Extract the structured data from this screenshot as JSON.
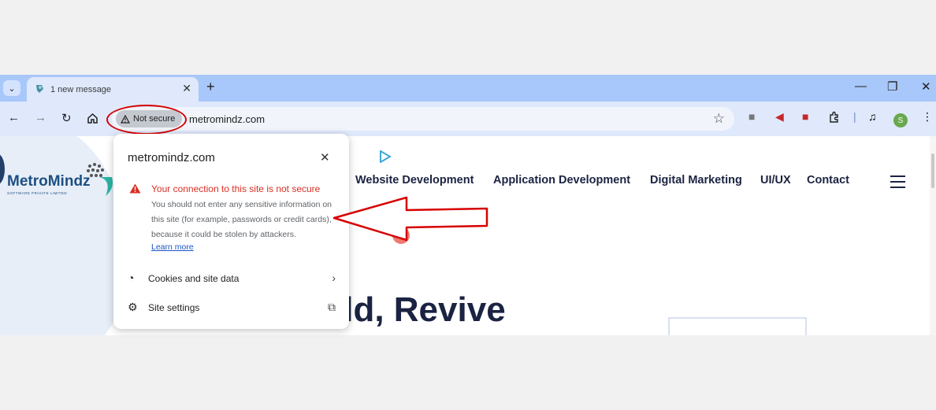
{
  "browser": {
    "tab_title": "1 new message",
    "tab_close": "✕",
    "new_tab": "+",
    "security_chip": "Not secure",
    "url": "metromindz.com",
    "window_controls": {
      "minimize": "—",
      "maximize": "❐",
      "close": "✕"
    },
    "profile_initial": "S"
  },
  "popup": {
    "domain": "metromindz.com",
    "warning_title": "Your connection to this site is not secure",
    "warning_body": "You should not enter any sensitive information on this site (for example, passwords or credit cards), because it could be stolen by attackers.",
    "learn_more": "Learn more",
    "cookies_label": "Cookies and site data",
    "site_settings_label": "Site settings"
  },
  "site": {
    "logo_text_1": "Metro",
    "logo_text_2": "Mindz",
    "logo_sub": "SOFTWARE PRIVATE LIMITED",
    "nav": [
      "Website Development",
      "Application Development",
      "Digital Marketing",
      "UI/UX",
      "Contact"
    ],
    "hero": "ild, Revive"
  },
  "colors": {
    "accent_red": "#d70000",
    "tab_strip": "#a8c7fa",
    "navy": "#1b2342"
  },
  "icons": [
    "chevron-down-icon",
    "favicon-icon",
    "back-icon",
    "forward-icon",
    "reload-icon",
    "home-icon",
    "warning-icon",
    "star-icon",
    "camera-icon",
    "megaphone-icon",
    "book-icon",
    "puzzle-icon",
    "media-icon",
    "avatar",
    "close-icon",
    "cookie-icon",
    "gear-icon",
    "external-link-icon",
    "chevron-right-icon",
    "play-icon",
    "menu-icon"
  ]
}
